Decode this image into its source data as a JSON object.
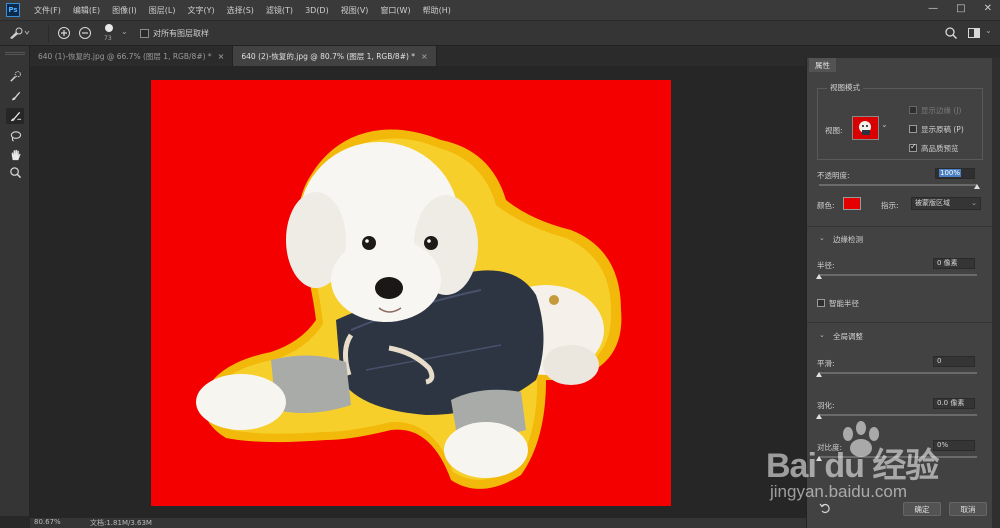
{
  "app": {
    "logo": "Ps"
  },
  "menu": [
    "文件(F)",
    "编辑(E)",
    "图像(I)",
    "图层(L)",
    "文字(Y)",
    "选择(S)",
    "滤镜(T)",
    "3D(D)",
    "视图(V)",
    "窗口(W)",
    "帮助(H)"
  ],
  "window_controls": {
    "minimize": "—",
    "maximize": "□",
    "close": "✕"
  },
  "options_bar": {
    "brush_size": "73",
    "sample_all_layers_label": "对所有图层取样",
    "sample_all_layers_checked": false
  },
  "tabs": [
    {
      "title": "640 (1)-恢复的.jpg @ 66.7% (图层 1, RGB/8#) *",
      "close": "×",
      "active": false
    },
    {
      "title": "640 (2)-恢复的.jpg @ 80.7% (图层 1, RGB/8#) *",
      "close": "×",
      "active": true
    }
  ],
  "tools": [
    "quick-selection",
    "brush",
    "refine-edge-brush",
    "lasso",
    "hand",
    "zoom"
  ],
  "status": {
    "zoom": "80.67%",
    "doc": "文档:1.81M/3.63M"
  },
  "panel": {
    "tab": "属性",
    "view_mode": {
      "title": "视图模式",
      "view_label": "视图:",
      "show_edge": {
        "label": "显示边缘 (J)",
        "checked": false,
        "enabled": false
      },
      "show_original": {
        "label": "显示原稿 (P)",
        "checked": false
      },
      "high_quality": {
        "label": "高品质预览",
        "checked": true
      }
    },
    "opacity": {
      "label": "不透明度:",
      "value": "100%",
      "level": 1.0
    },
    "color": {
      "label": "颜色:",
      "swatch": "#e40000"
    },
    "indicate": {
      "label": "指示:",
      "value": "被蒙版区域"
    },
    "edge_detection": {
      "title": "边缘检测",
      "radius": {
        "label": "半径:",
        "value": "0 像素",
        "level": 0.0
      },
      "smart_radius": {
        "label": "智能半径",
        "checked": false
      }
    },
    "global_refine": {
      "title": "全局调整",
      "smooth": {
        "label": "平滑:",
        "value": "0",
        "level": 0.0
      },
      "feather": {
        "label": "羽化:",
        "value": "0.0 像素",
        "level": 0.0
      },
      "contrast": {
        "label": "对比度:",
        "value": "0%",
        "level": 0.0
      }
    },
    "buttons": {
      "ok": "确定",
      "cancel": "取消"
    }
  },
  "watermark": {
    "brand": "Bai du 经验",
    "url": "jingyan.baidu.com"
  }
}
